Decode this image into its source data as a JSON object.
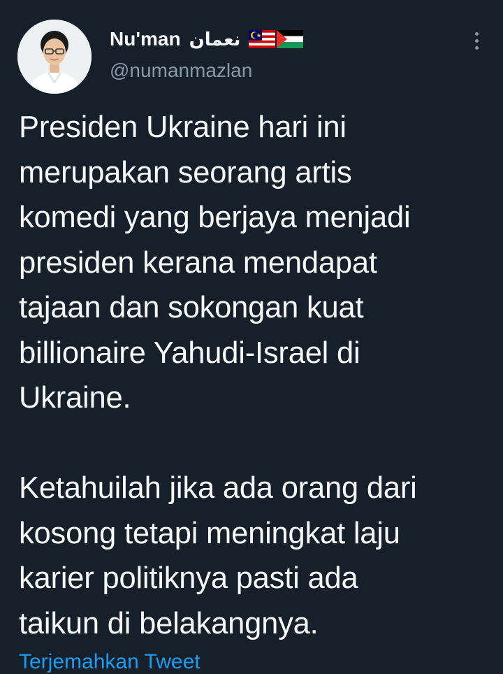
{
  "author": {
    "display_name": "Nu'man",
    "arabic_name": "نعمان",
    "handle": "@numanmazlan",
    "flags": [
      "malaysia-flag",
      "palestine-flag"
    ]
  },
  "tweet": {
    "lines": [
      "Presiden Ukraine hari ini",
      "merupakan seorang artis",
      "komedi yang berjaya menjadi",
      "presiden kerana mendapat",
      "tajaan dan sokongan kuat",
      "billionaire Yahudi-Israel di",
      "Ukraine.",
      "",
      "Ketahuilah jika ada orang dari",
      "kosong tetapi meningkat laju",
      "karier politiknya pasti ada",
      "taikun di belakangnya."
    ]
  },
  "footer": {
    "translate_label": "Terjemahkan Tweet"
  },
  "icons": {
    "more": "more-options-icon"
  },
  "colors": {
    "background": "#15202b",
    "text": "#f7f9f9",
    "secondary": "#8b98a5",
    "link": "#1d9bf0"
  }
}
